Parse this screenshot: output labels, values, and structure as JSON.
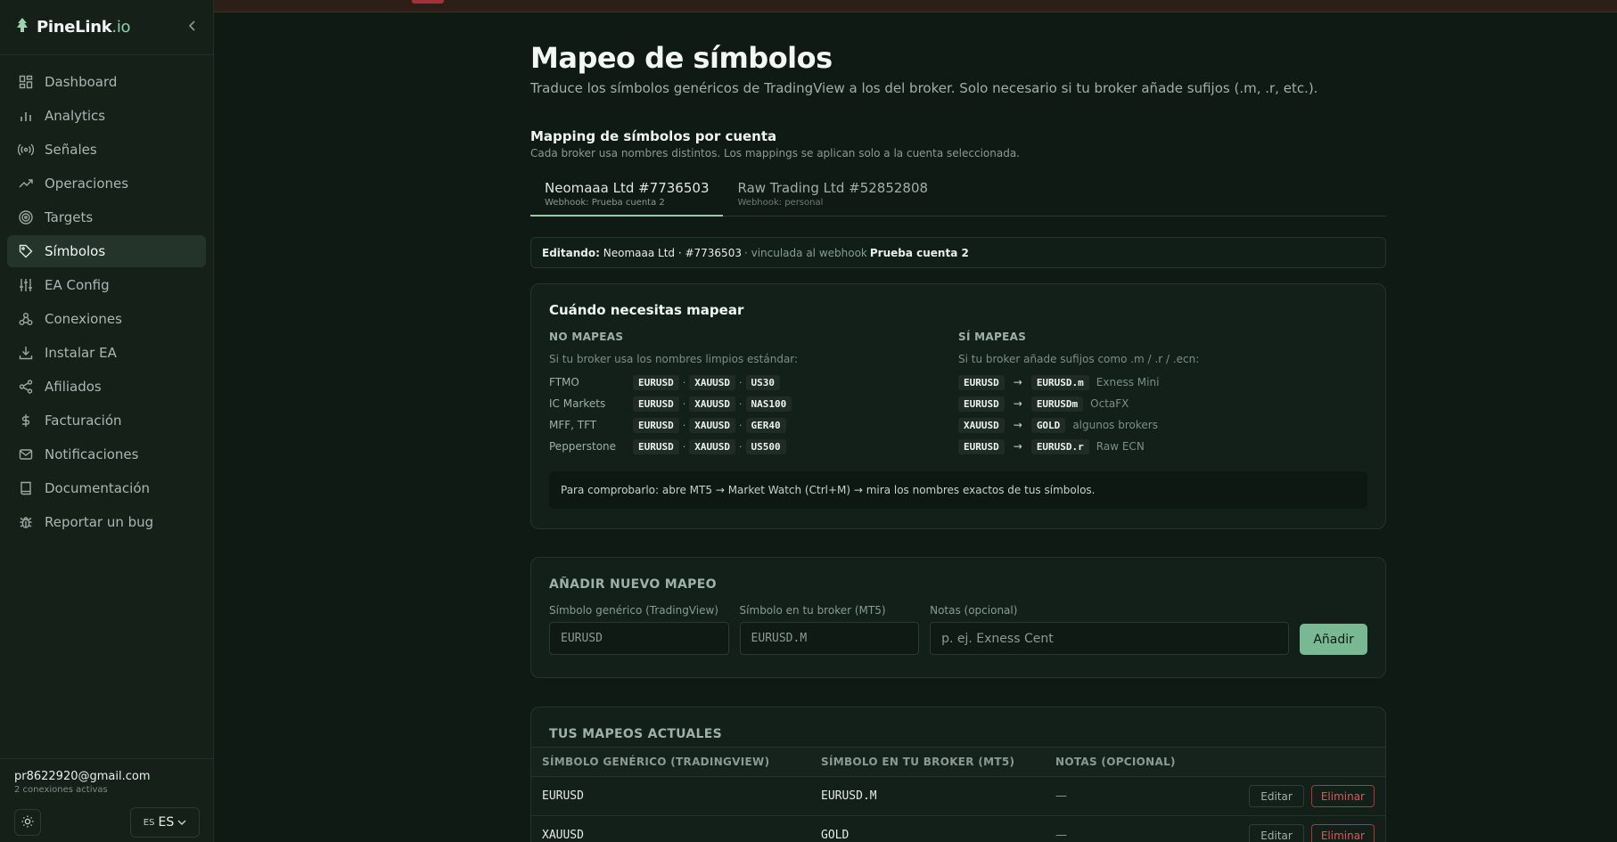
{
  "brand": {
    "name": "PineLink",
    "suffix": ".io"
  },
  "sidebar": {
    "items": [
      {
        "label": "Dashboard",
        "icon": "dashboard-icon"
      },
      {
        "label": "Analytics",
        "icon": "bar-chart-icon"
      },
      {
        "label": "Señales",
        "icon": "broadcast-icon"
      },
      {
        "label": "Operaciones",
        "icon": "trending-up-icon"
      },
      {
        "label": "Targets",
        "icon": "target-icon"
      },
      {
        "label": "Símbolos",
        "icon": "tag-icon"
      },
      {
        "label": "EA Config",
        "icon": "sliders-icon"
      },
      {
        "label": "Conexiones",
        "icon": "webhook-icon"
      },
      {
        "label": "Instalar EA",
        "icon": "download-icon"
      },
      {
        "label": "Afiliados",
        "icon": "share-icon"
      },
      {
        "label": "Facturación",
        "icon": "dollar-icon"
      },
      {
        "label": "Notificaciones",
        "icon": "mail-icon"
      },
      {
        "label": "Documentación",
        "icon": "book-icon"
      },
      {
        "label": "Reportar un bug",
        "icon": "bug-icon"
      }
    ],
    "active_index": 5
  },
  "footer": {
    "email": "pr8622920@gmail.com",
    "connections": "2 conexiones activas",
    "lang_flag": "ES",
    "lang": "ES"
  },
  "page": {
    "title": "Mapeo de símbolos",
    "subtitle": "Traduce los símbolos genéricos de TradingView a los del broker. Solo necesario si tu broker añade sufijos (.m, .r, etc.).",
    "section_title": "Mapping de símbolos por cuenta",
    "section_sub": "Cada broker usa nombres distintos. Los mappings se aplican solo a la cuenta seleccionada."
  },
  "tabs": [
    {
      "label": "Neomaaa Ltd #7736503",
      "sub": "Webhook: Prueba cuenta 2"
    },
    {
      "label": "Raw Trading Ltd #52852808",
      "sub": "Webhook: personal"
    }
  ],
  "editing": {
    "prefix": "Editando:",
    "account": "Neomaaa Ltd · #7736503",
    "mid": "· vinculada al webhook",
    "webhook": "Prueba cuenta 2"
  },
  "when": {
    "title": "Cuándo necesitas mapear",
    "no": {
      "heading": "NO MAPEAS",
      "desc": "Si tu broker usa los nombres limpios estándar:",
      "rows": [
        {
          "broker": "FTMO",
          "s1": "EURUSD",
          "s2": "XAUUSD",
          "s3": "US30"
        },
        {
          "broker": "IC Markets",
          "s1": "EURUSD",
          "s2": "XAUUSD",
          "s3": "NAS100"
        },
        {
          "broker": "MFF, TFT",
          "s1": "EURUSD",
          "s2": "XAUUSD",
          "s3": "GER40"
        },
        {
          "broker": "Pepperstone",
          "s1": "EURUSD",
          "s2": "XAUUSD",
          "s3": "US500"
        }
      ]
    },
    "yes": {
      "heading": "SÍ MAPEAS",
      "desc": "Si tu broker añade sufijos como .m / .r / .ecn:",
      "rows": [
        {
          "from": "EURUSD",
          "to": "EURUSD.m",
          "note": "Exness Mini"
        },
        {
          "from": "EURUSD",
          "to": "EURUSDm",
          "note": "OctaFX"
        },
        {
          "from": "XAUUSD",
          "to": "GOLD",
          "note": "algunos brokers"
        },
        {
          "from": "EURUSD",
          "to": "EURUSD.r",
          "note": "Raw ECN"
        }
      ]
    },
    "tip": "Para comprobarlo: abre MT5 → Market Watch (Ctrl+M) → mira los nombres exactos de tus símbolos."
  },
  "add": {
    "title": "AÑADIR NUEVO MAPEO",
    "generic_label": "Símbolo genérico (TradingView)",
    "generic_placeholder": "EURUSD",
    "broker_label": "Símbolo en tu broker (MT5)",
    "broker_placeholder": "EURUSD.M",
    "notes_label": "Notas (opcional)",
    "notes_placeholder": "p. ej. Exness Cent",
    "button": "Añadir"
  },
  "mappings": {
    "title": "TUS MAPEOS ACTUALES",
    "headers": [
      "SÍMBOLO GENÉRICO (TRADINGVIEW)",
      "SÍMBOLO EN TU BROKER (MT5)",
      "NOTAS (OPCIONAL)"
    ],
    "rows": [
      {
        "generic": "EURUSD",
        "broker": "EURUSD.M",
        "notes": "—"
      },
      {
        "generic": "XAUUSD",
        "broker": "GOLD",
        "notes": "—"
      }
    ],
    "edit_label": "Editar",
    "delete_label": "Eliminar"
  }
}
